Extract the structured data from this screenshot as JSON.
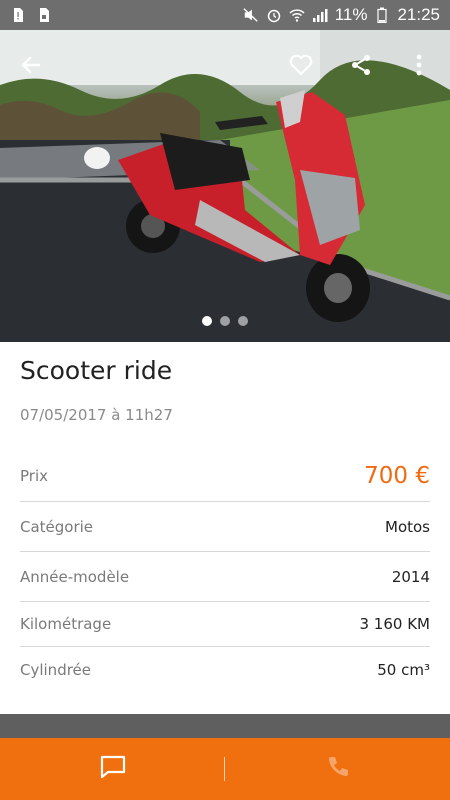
{
  "status_bar": {
    "battery_percent": "11%",
    "time": "21:25"
  },
  "hero": {
    "photo_alt": "red scooter parked on grass",
    "dot_count": 3,
    "active_dot": 0
  },
  "listing": {
    "title": "Scooter ride",
    "date": "07/05/2017 à 11h27",
    "price_label": "Prix",
    "price_value": "700 €",
    "details": [
      {
        "label": "Catégorie",
        "value": "Motos"
      },
      {
        "label": "Année-modèle",
        "value": "2014"
      },
      {
        "label": "Kilométrage",
        "value": "3 160 KM"
      },
      {
        "label": "Cylindrée",
        "value": "50 cm³"
      }
    ]
  },
  "colors": {
    "accent": "#f07010",
    "price": "#f26a10",
    "status_bar": "#6e6e6e"
  },
  "icons": {
    "back": "arrow-left-icon",
    "favorite": "heart-outline-icon",
    "share": "share-icon",
    "more": "more-vertical-icon",
    "message": "chat-bubble-icon",
    "call": "phone-icon"
  }
}
